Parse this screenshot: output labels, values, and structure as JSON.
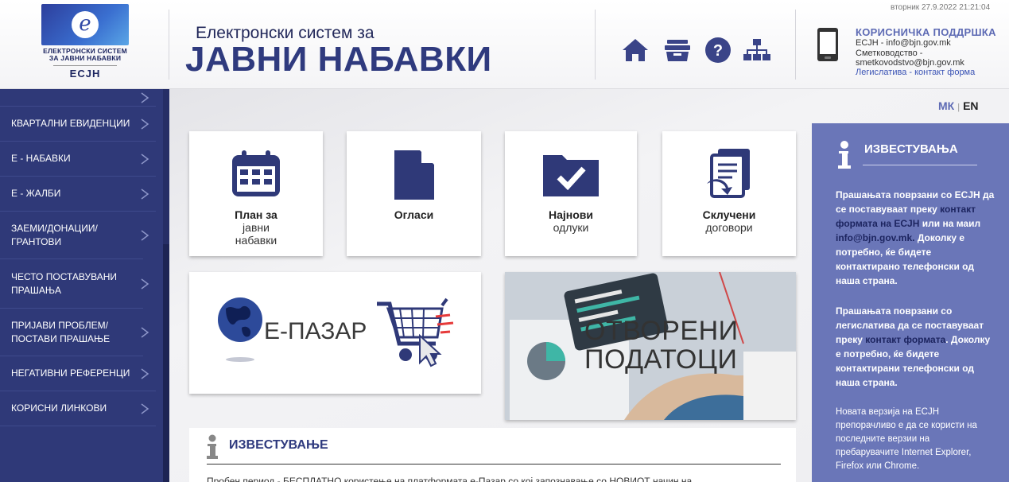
{
  "header": {
    "logo_text": "ЕЛЕКТРОНСКИ СИСТЕМ ЗА ЈАВНИ НАБАВКИ",
    "logo_text_line1": "ЕЛЕКТРОНСКИ СИСТЕМ",
    "logo_text_line2": "ЗА ЈАВНИ НАБАВКИ",
    "logo_abbr": "ЕСЈН",
    "logo_letter": "e",
    "title_small": "Електронски систем за",
    "title_big": "ЈАВНИ НАБАВКИ",
    "datetime": "вторник 27.9.2022 21:21:04",
    "icons": [
      "home-icon",
      "archive-icon",
      "help-icon",
      "sitemap-icon"
    ]
  },
  "support": {
    "title": "КОРИСНИЧКА ПОДДРШКА",
    "line1": "ЕСЈН - info@bjn.gov.mk",
    "line2": "Сметководство -",
    "line3": "smetkovodstvo@bjn.gov.mk",
    "link": "Легислатива - контакт форма"
  },
  "sidebar": {
    "items": [
      {
        "label": ""
      },
      {
        "label": "КВАРТАЛНИ ЕВИДЕНЦИИ"
      },
      {
        "label": "Е - НАБАВКИ"
      },
      {
        "label": "Е - ЖАЛБИ"
      },
      {
        "label": "ЗАЕМИ/ДОНАЦИИ/ ГРАНТОВИ"
      },
      {
        "label": "ЧЕСТО ПОСТАВУВАНИ ПРАШАЊА"
      },
      {
        "label": "ПРИЈАВИ ПРОБЛЕМ/ ПОСТАВИ ПРАШАЊЕ"
      },
      {
        "label": "НЕГАТИВНИ РЕФЕРЕНЦИ"
      },
      {
        "label": "КОРИСНИ ЛИНКОВИ"
      }
    ]
  },
  "lang": {
    "mk": "МК",
    "sep": "|",
    "en": "EN"
  },
  "tiles": {
    "plan": {
      "bold": "План за",
      "rest1": "јавни",
      "rest2": "набавки"
    },
    "oglasi": {
      "bold": "Огласи"
    },
    "odluki": {
      "bold": "Најнови",
      "rest1": "одлуки"
    },
    "dogovori": {
      "bold": "Склучени",
      "rest1": "договори"
    },
    "epazar": {
      "label": "Е-ПАЗАР"
    },
    "otvoreni": {
      "line1": "ОТВОРЕНИ",
      "line2": "ПОДАТОЦИ"
    }
  },
  "news": {
    "title": "ИЗВЕСТУВАЊЕ",
    "text": "Пробен период - БЕСПЛАТНО користење на платформата е-Пазар со кој запознавање со НОВИОТ начин на"
  },
  "info": {
    "title": "ИЗВЕСТУВАЊА",
    "p1_a": "Прашањата поврзани со ЕСЈН да се поставуваат преку",
    "p1_link": "контакт формата на ЕСЈН",
    "p1_b": "или на маил",
    "p1_email": "info@bjn.gov.mk.",
    "p1_c": "Доколку е потребно, ќе бидете контактирано телефонски од наша страна.",
    "p2_a": "Прашањата поврзани со легислатива да се поставуваат преку",
    "p2_link": "контакт формата",
    "p2_b": ". Доколку е потребно, ќе бидете контактирани телефонски од наша страна.",
    "p3": "Новата верзија на ЕСЈН препорачливо е да се користи на последните верзии на пребарувачите Internet Explorer, Firefox или Chrome."
  },
  "colors": {
    "navy": "#2f3978",
    "accent": "#5d6ab4",
    "icon": "#3a4488",
    "panel": "#6a76b8"
  }
}
